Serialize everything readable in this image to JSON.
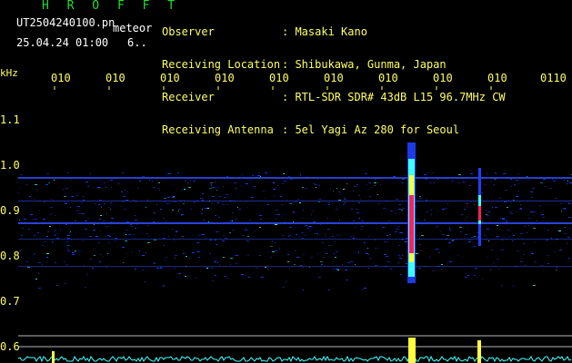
{
  "header": {
    "brand": "H R O F F T",
    "filename": "UT2504240100.pn",
    "filetype": "meteor",
    "datetime": "25.04.24 01:00",
    "extra": "6.."
  },
  "info": [
    {
      "key": "Observer",
      "value": ": Masaki Kano"
    },
    {
      "key": "Receiving Location",
      "value": ": Shibukawa, Gunma, Japan"
    },
    {
      "key": "Receiver",
      "value": ": RTL-SDR SDR# 43dB L15 96.7MHz CW"
    },
    {
      "key": "Receiving Antenna",
      "value": ": 5el Yagi Az 280 for Seoul"
    }
  ],
  "axes": {
    "unit": "kHz",
    "x_ticks": [
      "010",
      "010",
      "010",
      "010",
      "010",
      "010",
      "010",
      "010",
      "010",
      "0110"
    ],
    "y_ticks": [
      "1.1",
      "1.0",
      "0.9",
      "0.8",
      "0.7",
      "0.6"
    ]
  },
  "colors": {
    "background": "#000000",
    "title_green": "#22dd33",
    "label_yellow": "#ffff66",
    "noise_blue": "#2040ff",
    "noise_cyan": "#40ffff",
    "echo_red": "#ff2060",
    "echo_yellow": "#ffff40"
  }
}
